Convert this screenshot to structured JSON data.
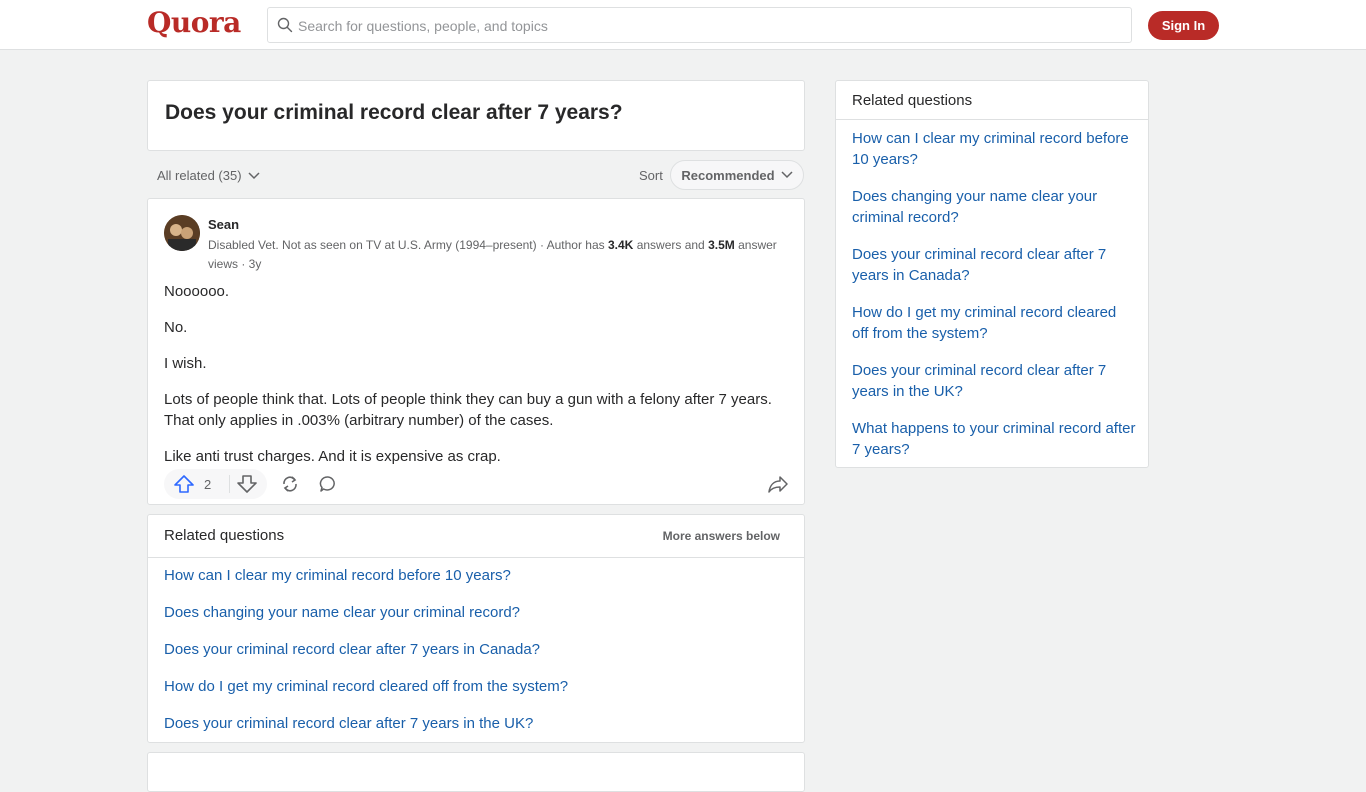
{
  "header": {
    "logo": "Quora",
    "search_placeholder": "Search for questions, people, and topics",
    "signin_label": "Sign In"
  },
  "question": {
    "title": "Does your criminal record clear after 7 years?"
  },
  "filters": {
    "all_related": "All related (35)",
    "sort_label": "Sort",
    "sort_value": "Recommended"
  },
  "answer": {
    "author": "Sean",
    "credential_prefix": "Disabled Vet. Not as seen on TV at U.S. Army (1994–present) · Author has ",
    "answers_count": "3.4K",
    "credential_mid": " answers and ",
    "views_count": "3.5M",
    "credential_suffix": " answer views · 3y",
    "paragraphs": [
      "Noooooo.",
      "No.",
      "I wish.",
      "Lots of people think that. Lots of people think they can buy a gun with a felony after 7 years. That only applies in .003% (arbitrary number) of the cases.",
      "Like anti trust charges. And it is expensive as crap."
    ],
    "upvotes": "2"
  },
  "related_inline": {
    "title": "Related questions",
    "more_label": "More answers below",
    "items": [
      "How can I clear my criminal record before 10 years?",
      "Does changing your name clear your criminal record?",
      "Does your criminal record clear after 7 years in Canada?",
      "How do I get my criminal record cleared off from the system?",
      "Does your criminal record clear after 7 years in the UK?"
    ]
  },
  "sidebar": {
    "title": "Related questions",
    "items": [
      "How can I clear my criminal record before 10 years?",
      "Does changing your name clear your criminal record?",
      "Does your criminal record clear after 7 years in Canada?",
      "How do I get my criminal record cleared off from the system?",
      "Does your criminal record clear after 7 years in the UK?",
      "What happens to your criminal record after 7 years?"
    ]
  },
  "colors": {
    "brand": "#b92b27",
    "link": "#195faa",
    "upvote": "#2e69ff"
  }
}
